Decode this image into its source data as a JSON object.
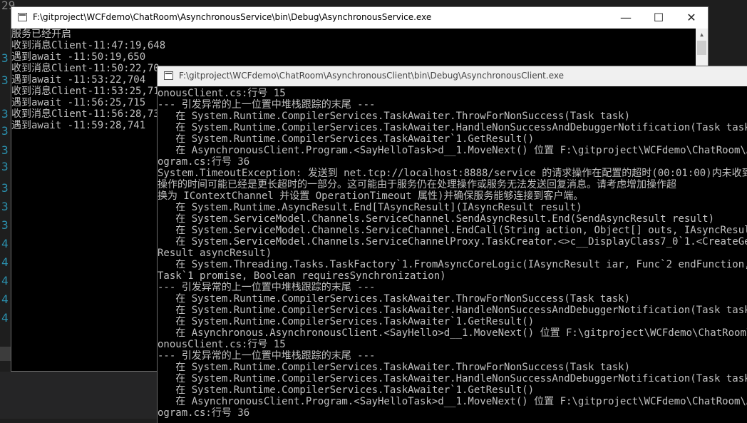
{
  "ide": {
    "line_numbers": [
      "29",
      "3",
      "3",
      "3",
      "3",
      "3",
      "3",
      "3",
      "3",
      "3",
      "4",
      "4",
      "4",
      "4",
      "4"
    ]
  },
  "window_service": {
    "title": "F:\\gitproject\\WCFdemo\\ChatRoom\\AsynchronousService\\bin\\Debug\\AsynchronousService.exe",
    "controls": {
      "minimize": "—",
      "maximize": "☐",
      "close": "✕"
    },
    "lines": [
      "服务已经开启",
      "收到消息Client-11:47:19,648",
      "遇到await -11:50:19,650",
      "收到消息Client-11:50:22,70",
      "遇到await -11:53:22,704",
      "收到消息Client-11:53:25,71",
      "遇到await -11:56:25,715",
      "收到消息Client-11:56:28,73",
      "遇到await -11:59:28,741"
    ]
  },
  "window_client": {
    "title": "F:\\gitproject\\WCFdemo\\ChatRoom\\AsynchronousClient\\bin\\Debug\\AsynchronousClient.exe",
    "lines": [
      "onousClient.cs:行号 15",
      "--- 引发异常的上一位置中堆栈跟踪的末尾 ---",
      "   在 System.Runtime.CompilerServices.TaskAwaiter.ThrowForNonSuccess(Task task)",
      "   在 System.Runtime.CompilerServices.TaskAwaiter.HandleNonSuccessAndDebuggerNotification(Task task)",
      "   在 System.Runtime.CompilerServices.TaskAwaiter`1.GetResult()",
      "   在 AsynchronousClient.Program.<SayHelloTask>d__1.MoveNext() 位置 F:\\gitproject\\WCFdemo\\ChatRoom\\Async",
      "ogram.cs:行号 36",
      "System.TimeoutException: 发送到 net.tcp://localhost:8888/service 的请求操作在配置的超时(00:01:00)内未收到",
      "操作的时间可能已经是更长超时的一部分。这可能由于服务仍在处理操作或服务无法发送回复消息。请考虑增加操作超",
      "换为 IContextChannel 并设置 OperationTimeout 属性)并确保服务能够连接到客户端。",
      "   在 System.Runtime.AsyncResult.End[TAsyncResult](IAsyncResult result)",
      "   在 System.ServiceModel.Channels.ServiceChannel.SendAsyncResult.End(SendAsyncResult result)",
      "   在 System.ServiceModel.Channels.ServiceChannel.EndCall(String action, Object[] outs, IAsyncResult res",
      "   在 System.ServiceModel.Channels.ServiceChannelProxy.TaskCreator.<>c__DisplayClass7_0`1.<CreateGeneric",
      "Result asyncResult)",
      "   在 System.Threading.Tasks.TaskFactory`1.FromAsyncCoreLogic(IAsyncResult iar, Func`2 endFunction, Acti",
      "Task`1 promise, Boolean requiresSynchronization)",
      "--- 引发异常的上一位置中堆栈跟踪的末尾 ---",
      "   在 System.Runtime.CompilerServices.TaskAwaiter.ThrowForNonSuccess(Task task)",
      "   在 System.Runtime.CompilerServices.TaskAwaiter.HandleNonSuccessAndDebuggerNotification(Task task)",
      "   在 System.Runtime.CompilerServices.TaskAwaiter`1.GetResult()",
      "   在 Asynchronous.AsynchronousClient.<SayHello>d__1.MoveNext() 位置 F:\\gitproject\\WCFdemo\\ChatRoom\\Asyn",
      "onousClient.cs:行号 15",
      "--- 引发异常的上一位置中堆栈跟踪的末尾 ---",
      "   在 System.Runtime.CompilerServices.TaskAwaiter.ThrowForNonSuccess(Task task)",
      "   在 System.Runtime.CompilerServices.TaskAwaiter.HandleNonSuccessAndDebuggerNotification(Task task)",
      "   在 System.Runtime.CompilerServices.TaskAwaiter`1.GetResult()",
      "   在 AsynchronousClient.Program.<SayHelloTask>d__1.MoveNext() 位置 F:\\gitproject\\WCFdemo\\ChatRoom\\Async",
      "ogram.cs:行号 36"
    ]
  }
}
